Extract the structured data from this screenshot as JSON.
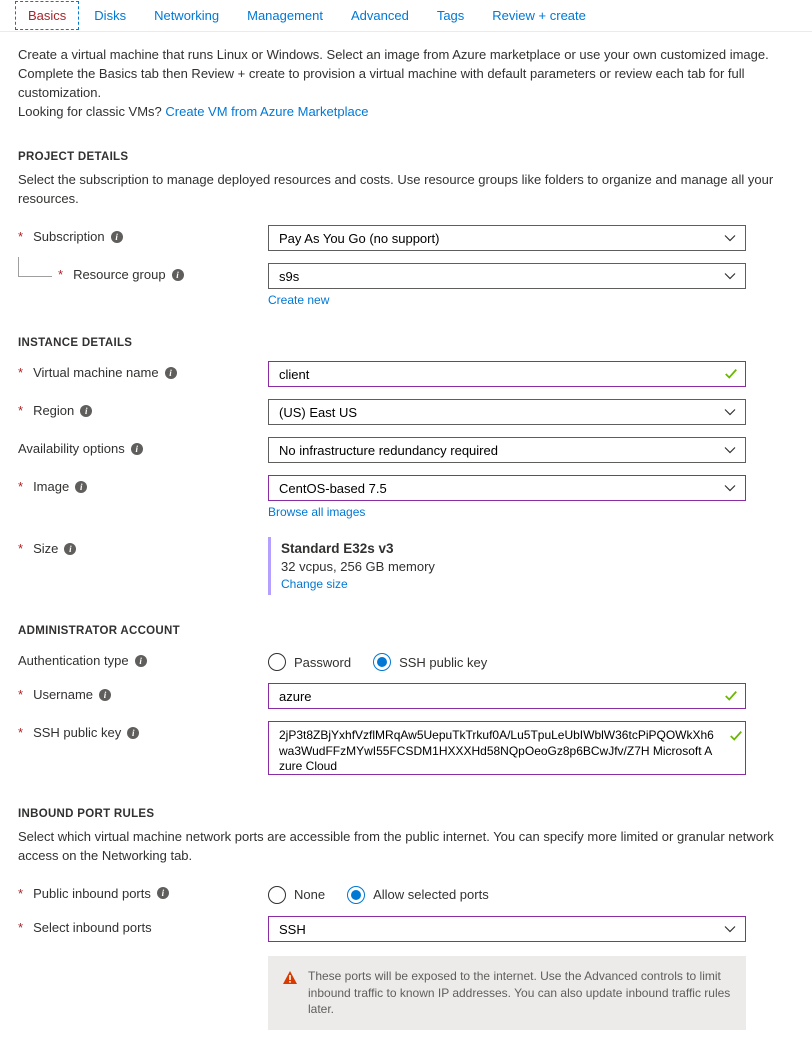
{
  "tabs": [
    "Basics",
    "Disks",
    "Networking",
    "Management",
    "Advanced",
    "Tags",
    "Review + create"
  ],
  "intro": {
    "line1": "Create a virtual machine that runs Linux or Windows. Select an image from Azure marketplace or use your own customized image.",
    "line2": "Complete the Basics tab then Review + create to provision a virtual machine with default parameters or review each tab for full customization.",
    "line3_prefix": "Looking for classic VMs?  ",
    "line3_link": "Create VM from Azure Marketplace"
  },
  "project": {
    "header": "PROJECT DETAILS",
    "desc": "Select the subscription to manage deployed resources and costs. Use resource groups like folders to organize and manage all your resources.",
    "subscription_label": "Subscription",
    "subscription_value": "Pay As You Go (no support)",
    "resource_group_label": "Resource group",
    "resource_group_value": "s9s",
    "create_new": "Create new"
  },
  "instance": {
    "header": "INSTANCE DETAILS",
    "vm_name_label": "Virtual machine name",
    "vm_name_value": "client",
    "region_label": "Region",
    "region_value": "(US) East US",
    "avail_label": "Availability options",
    "avail_value": "No infrastructure redundancy required",
    "image_label": "Image",
    "image_value": "CentOS-based 7.5",
    "browse_images": "Browse all images",
    "size_label": "Size",
    "size_name": "Standard E32s v3",
    "size_desc": "32 vcpus, 256 GB memory",
    "change_size": "Change size"
  },
  "admin": {
    "header": "ADMINISTRATOR ACCOUNT",
    "auth_label": "Authentication type",
    "auth_password": "Password",
    "auth_ssh": "SSH public key",
    "username_label": "Username",
    "username_value": "azure",
    "ssh_key_label": "SSH public key",
    "ssh_key_value": "2jP3t8ZBjYxhfVzflMRqAw5UepuTkTrkuf0A/Lu5TpuLeUbIWblW36tcPiPQOWkXh6wa3WudFFzMYwI55FCSDM1HXXXHd58NQpOeoGz8p6BCwJfv/Z7H Microsoft Azure Cloud"
  },
  "ports": {
    "header": "INBOUND PORT RULES",
    "desc": "Select which virtual machine network ports are accessible from the public internet. You can specify more limited or granular network access on the Networking tab.",
    "public_label": "Public inbound ports",
    "opt_none": "None",
    "opt_allow": "Allow selected ports",
    "select_label": "Select inbound ports",
    "select_value": "SSH",
    "warn": "These ports will be exposed to the internet. Use the Advanced controls to limit inbound traffic to known IP addresses. You can also update inbound traffic rules later."
  }
}
